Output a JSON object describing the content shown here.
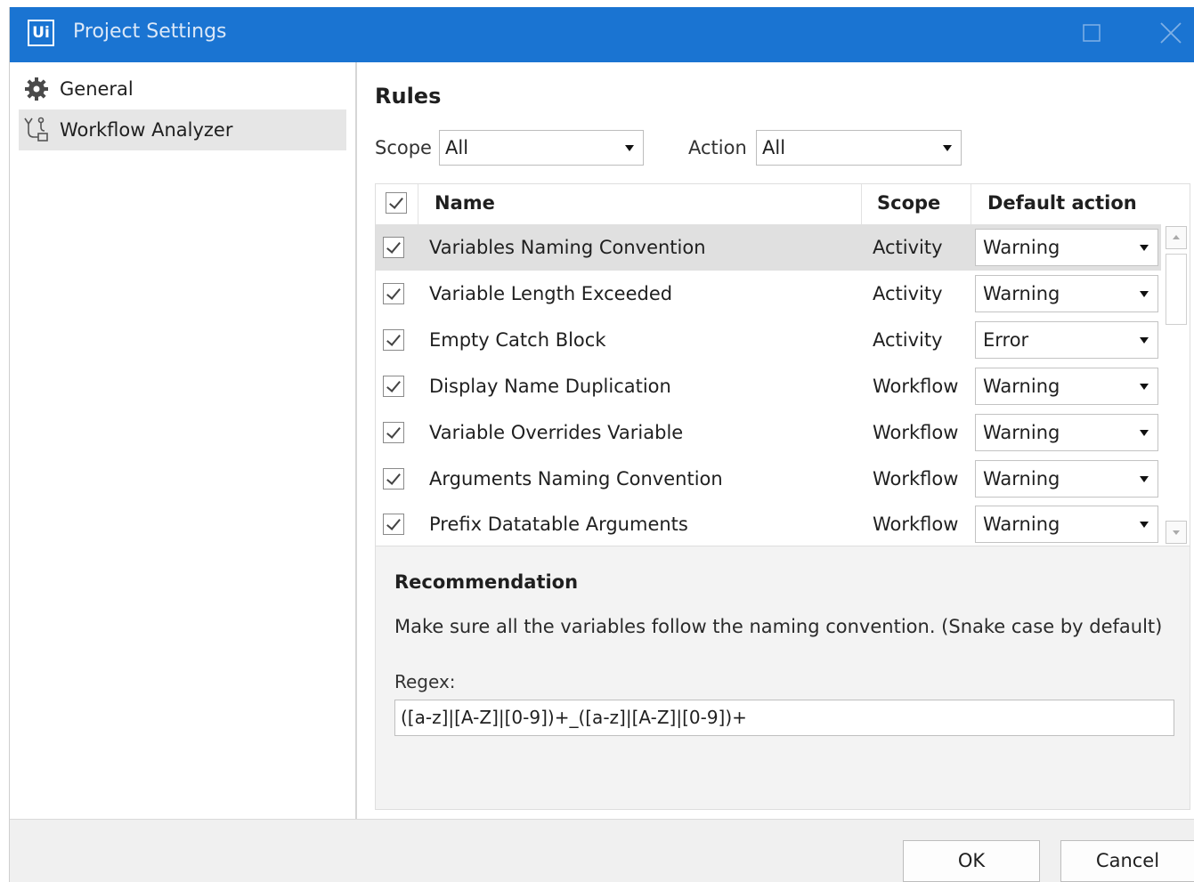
{
  "window": {
    "title": "Project Settings",
    "logo": "Ui",
    "colors": {
      "titlebar": "#1a74d2",
      "selection": "#e0e0e0"
    }
  },
  "sidebar": {
    "items": [
      {
        "label": "General",
        "icon": "gear-icon",
        "selected": false
      },
      {
        "label": "Workflow Analyzer",
        "icon": "workflow-analyzer-icon",
        "selected": true
      }
    ]
  },
  "main": {
    "heading": "Rules",
    "scope_label": "Scope",
    "scope_value": "All",
    "action_label": "Action",
    "action_value": "All"
  },
  "table": {
    "columns": [
      "Name",
      "Scope",
      "Default action"
    ],
    "rows": [
      {
        "name": "Variables Naming Convention",
        "scope": "Activity",
        "action": "Warning",
        "checked": true,
        "selected": true
      },
      {
        "name": "Variable Length Exceeded",
        "scope": "Activity",
        "action": "Warning",
        "checked": true,
        "selected": false
      },
      {
        "name": "Empty Catch Block",
        "scope": "Activity",
        "action": "Error",
        "checked": true,
        "selected": false
      },
      {
        "name": "Display Name Duplication",
        "scope": "Workflow",
        "action": "Warning",
        "checked": true,
        "selected": false
      },
      {
        "name": "Variable Overrides Variable",
        "scope": "Workflow",
        "action": "Warning",
        "checked": true,
        "selected": false
      },
      {
        "name": "Arguments Naming Convention",
        "scope": "Workflow",
        "action": "Warning",
        "checked": true,
        "selected": false
      },
      {
        "name": "Prefix Datatable Arguments",
        "scope": "Workflow",
        "action": "Warning",
        "checked": true,
        "selected": false
      }
    ]
  },
  "recommendation": {
    "title": "Recommendation",
    "text": "Make sure all the variables follow the naming convention. (Snake case by default)",
    "regex_label": "Regex:",
    "regex_value": "([a-z]|[A-Z]|[0-9])+_([a-z]|[A-Z]|[0-9])+"
  },
  "footer": {
    "ok_label": "OK",
    "cancel_label": "Cancel"
  }
}
